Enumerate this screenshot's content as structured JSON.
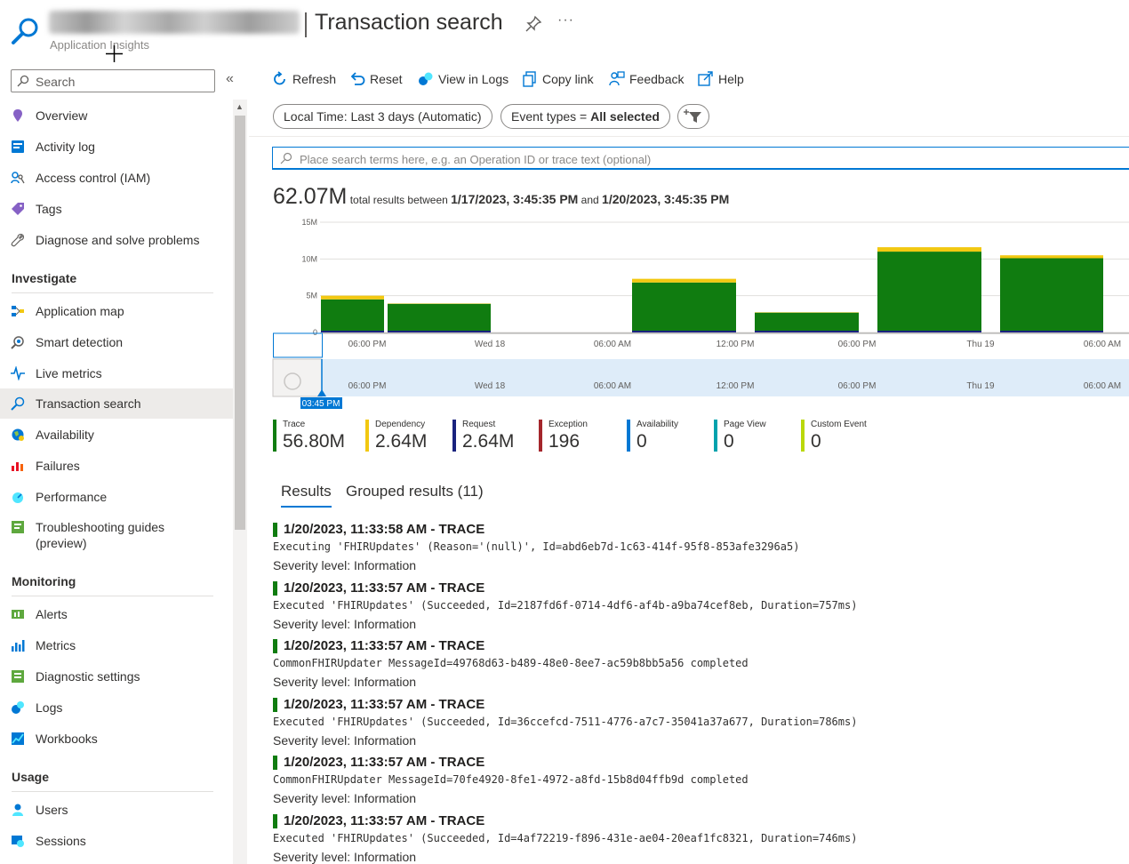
{
  "header": {
    "resource_type": "Application Insights",
    "title": "Transaction search"
  },
  "sidebar": {
    "search_placeholder": "Search",
    "top_items": [
      {
        "label": "Overview"
      },
      {
        "label": "Activity log"
      },
      {
        "label": "Access control (IAM)"
      },
      {
        "label": "Tags"
      },
      {
        "label": "Diagnose and solve problems"
      }
    ],
    "sections": [
      {
        "title": "Investigate",
        "items": [
          {
            "label": "Application map"
          },
          {
            "label": "Smart detection"
          },
          {
            "label": "Live metrics"
          },
          {
            "label": "Transaction search"
          },
          {
            "label": "Availability"
          },
          {
            "label": "Failures"
          },
          {
            "label": "Performance"
          },
          {
            "label": "Troubleshooting guides\n(preview)"
          }
        ]
      },
      {
        "title": "Monitoring",
        "items": [
          {
            "label": "Alerts"
          },
          {
            "label": "Metrics"
          },
          {
            "label": "Diagnostic settings"
          },
          {
            "label": "Logs"
          },
          {
            "label": "Workbooks"
          }
        ]
      },
      {
        "title": "Usage",
        "items": [
          {
            "label": "Users"
          },
          {
            "label": "Sessions"
          }
        ]
      }
    ]
  },
  "toolbar": {
    "refresh": "Refresh",
    "reset": "Reset",
    "view_in_logs": "View in Logs",
    "copy_link": "Copy link",
    "feedback": "Feedback",
    "help": "Help"
  },
  "filters": {
    "time": "Local Time: Last 3 days (Automatic)",
    "event_types_label": "Event types = ",
    "event_types_value": "All selected"
  },
  "search": {
    "placeholder": "Place search terms here, e.g. an Operation ID or trace text (optional)"
  },
  "summary": {
    "total": "62.07M",
    "between_text": " total results between ",
    "start": "1/17/2023, 3:45:35 PM",
    "and_text": " and ",
    "end": "1/20/2023, 3:45:35 PM"
  },
  "chart_data": {
    "type": "bar",
    "y_ticks": [
      "15M",
      "10M",
      "5M",
      "0"
    ],
    "ylim": [
      0,
      15
    ],
    "x_ticks": [
      "06:00 PM",
      "Wed 18",
      "06:00 AM",
      "12:00 PM",
      "06:00 PM",
      "Thu 19",
      "06:00 AM"
    ],
    "brush_label": "03:45 PM",
    "series": [
      {
        "name": "Trace",
        "values": [
          4.5,
          3.9,
          6.8,
          2.7,
          11.0,
          10.1
        ]
      },
      {
        "name": "Dependency",
        "values": [
          0.5,
          0.05,
          0.5,
          0.05,
          0.6,
          0.4
        ]
      }
    ],
    "colors": {
      "trace": "#107c10",
      "dependency": "#f2c811",
      "request": "#1a237e"
    }
  },
  "legend": [
    {
      "name": "Trace",
      "value": "56.80M",
      "color": "#107c10"
    },
    {
      "name": "Dependency",
      "value": "2.64M",
      "color": "#f2c811"
    },
    {
      "name": "Request",
      "value": "2.64M",
      "color": "#1a237e"
    },
    {
      "name": "Exception",
      "value": "196",
      "color": "#a4262c"
    },
    {
      "name": "Availability",
      "value": "0",
      "color": "#0078d4"
    },
    {
      "name": "Page View",
      "value": "0",
      "color": "#00a2ad"
    },
    {
      "name": "Custom Event",
      "value": "0",
      "color": "#bad80a"
    }
  ],
  "tabs": [
    {
      "label": "Results"
    },
    {
      "label": "Grouped results (11)"
    }
  ],
  "results": [
    {
      "header": "1/20/2023, 11:33:58 AM - TRACE",
      "message": "Executing 'FHIRUpdates' (Reason='(null)', Id=abd6eb7d-1c63-414f-95f8-853afe3296a5)",
      "severity": "Severity level: Information"
    },
    {
      "header": "1/20/2023, 11:33:57 AM - TRACE",
      "message": "Executed 'FHIRUpdates' (Succeeded, Id=2187fd6f-0714-4df6-af4b-a9ba74cef8eb, Duration=757ms)",
      "severity": "Severity level: Information"
    },
    {
      "header": "1/20/2023, 11:33:57 AM - TRACE",
      "message": "CommonFHIRUpdater MessageId=49768d63-b489-48e0-8ee7-ac59b8bb5a56 completed",
      "severity": "Severity level: Information"
    },
    {
      "header": "1/20/2023, 11:33:57 AM - TRACE",
      "message": "Executed 'FHIRUpdates' (Succeeded, Id=36ccefcd-7511-4776-a7c7-35041a37a677, Duration=786ms)",
      "severity": "Severity level: Information"
    },
    {
      "header": "1/20/2023, 11:33:57 AM - TRACE",
      "message": "CommonFHIRUpdater MessageId=70fe4920-8fe1-4972-a8fd-15b8d04ffb9d completed",
      "severity": "Severity level: Information"
    },
    {
      "header": "1/20/2023, 11:33:57 AM - TRACE",
      "message": "Executed 'FHIRUpdates' (Succeeded, Id=4af72219-f896-431e-ae04-20eaf1fc8321, Duration=746ms)",
      "severity": "Severity level: Information"
    }
  ]
}
